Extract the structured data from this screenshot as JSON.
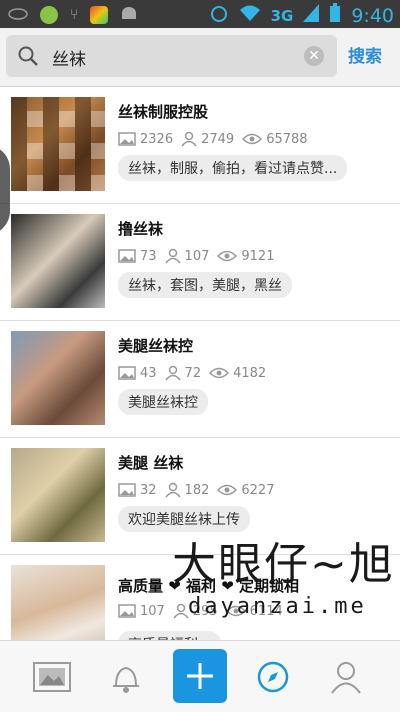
{
  "status": {
    "time": "9:40",
    "network": "3G"
  },
  "search": {
    "query": "丝袜",
    "button": "搜索"
  },
  "items": [
    {
      "title": "丝袜制服控股",
      "images": "2326",
      "users": "2749",
      "views": "65788",
      "tag": "丝袜，制服，偷拍，看过请点赞..."
    },
    {
      "title": "撸丝袜",
      "images": "73",
      "users": "107",
      "views": "9121",
      "tag": "丝袜，套图，美腿，黑丝"
    },
    {
      "title": "美腿丝袜控",
      "images": "43",
      "users": "72",
      "views": "4182",
      "tag": "美腿丝袜控"
    },
    {
      "title": "美腿  丝袜",
      "images": "32",
      "users": "182",
      "views": "6227",
      "tag": "欢迎美腿丝袜上传"
    },
    {
      "title": "高质量 ❤ 福利 ❤ 定期锁相",
      "images": "107",
      "users": "295",
      "views": "6114",
      "tag": "高质量福利..."
    }
  ],
  "watermark": {
    "main": "大眼仔~旭",
    "sub": "dayanzai.me"
  },
  "nav": [
    "gallery-icon",
    "bell-icon",
    "add-icon",
    "compass-icon",
    "profile-icon"
  ]
}
